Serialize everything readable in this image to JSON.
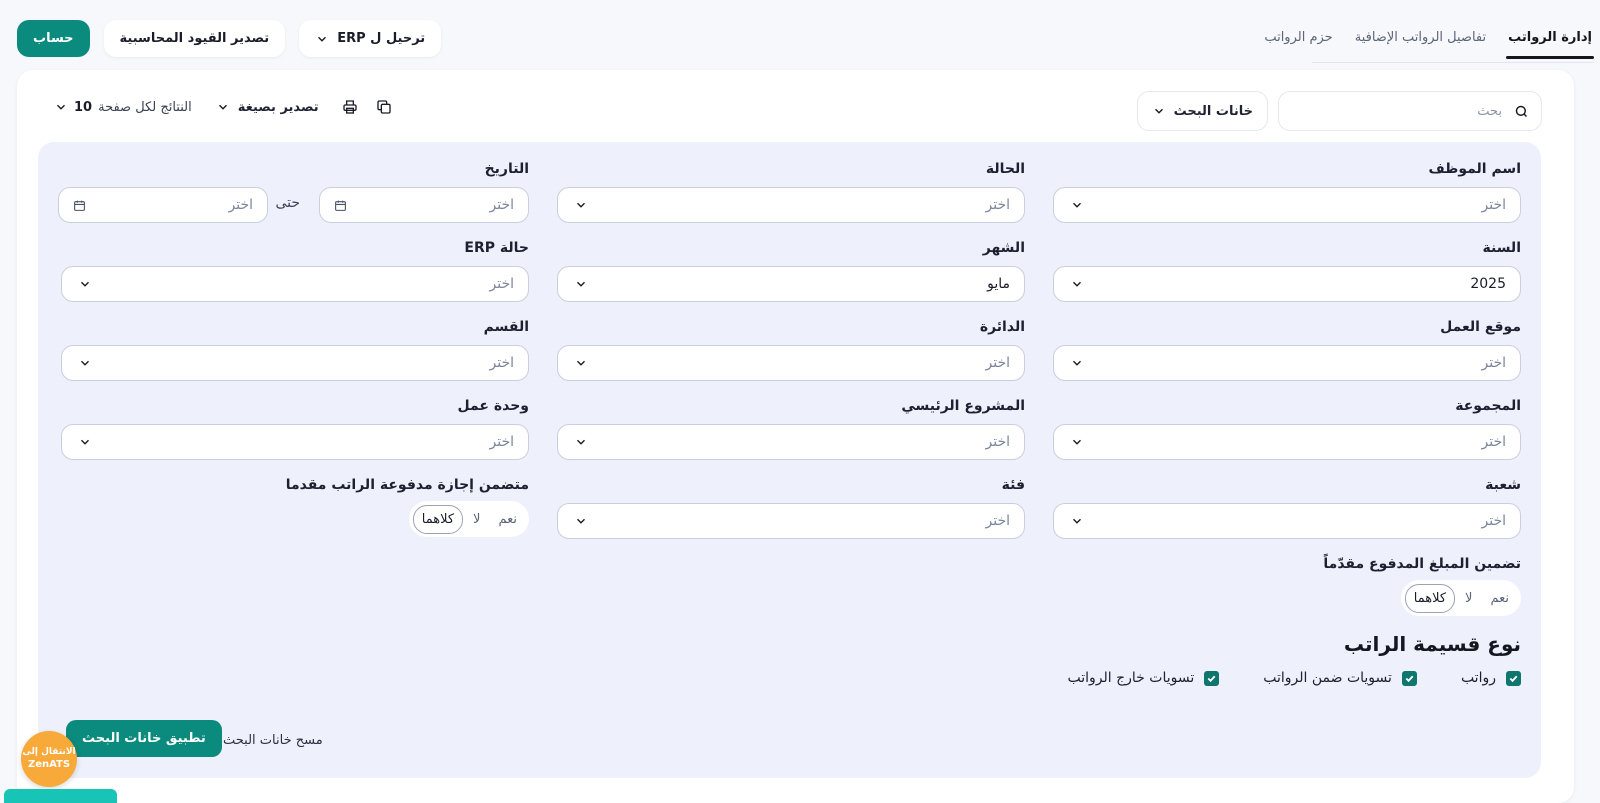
{
  "tabs": [
    {
      "label": "إدارة الرواتب",
      "active": true
    },
    {
      "label": "تفاصيل الرواتب الإضافية",
      "active": false
    },
    {
      "label": "حزم الرواتب",
      "active": false
    }
  ],
  "actions": {
    "account": "حساب",
    "export_entries": "تصدير القيود المحاسبية",
    "post_erp": "ترحيل ل ERP"
  },
  "search": {
    "placeholder": "بحث"
  },
  "search_fields_button": "خانات البحث",
  "toolbar": {
    "export_label": "تصدير بصيغة",
    "per_page_label": "النتائج لكل صفحة",
    "per_page_value": "10"
  },
  "filters": {
    "employee_name": {
      "label": "اسم الموظف",
      "value": "اختر"
    },
    "status": {
      "label": "الحالة",
      "value": "اختر"
    },
    "date": {
      "label": "التاريخ",
      "from": "اختر",
      "until": "حتى",
      "to": "اختر"
    },
    "year": {
      "label": "السنة",
      "value": "2025"
    },
    "month": {
      "label": "الشهر",
      "value": "مايو"
    },
    "erp_status": {
      "label": "حالة ERP",
      "value": "اختر"
    },
    "work_location": {
      "label": "موقع العمل",
      "value": "اختر"
    },
    "department": {
      "label": "الدائرة",
      "value": "اختر"
    },
    "section": {
      "label": "القسم",
      "value": "اختر"
    },
    "group": {
      "label": "المجموعة",
      "value": "اختر"
    },
    "main_project": {
      "label": "المشروع الرئيسي",
      "value": "اختر"
    },
    "work_unit": {
      "label": "وحدة عمل",
      "value": "اختر"
    },
    "branch": {
      "label": "شعبة",
      "value": "اختر"
    },
    "category": {
      "label": "فئة",
      "value": "اختر"
    },
    "includes_prepaid_leave": {
      "label": "متضمن إجازة مدفوعة الراتب مقدما",
      "options": [
        "نعم",
        "لا",
        "كلاهما"
      ],
      "selected": "كلاهما"
    },
    "include_prepaid_amount": {
      "label": "تضمين المبلغ المدفوع مقدّماً",
      "options": [
        "نعم",
        "لا",
        "كلاهما"
      ],
      "selected": "كلاهما"
    }
  },
  "slip_type": {
    "title": "نوع قسيمة الراتب",
    "options": [
      {
        "label": "رواتب",
        "checked": true
      },
      {
        "label": "تسويات ضمن الرواتب",
        "checked": true
      },
      {
        "label": "تسويات خارج الرواتب",
        "checked": true
      }
    ]
  },
  "buttons": {
    "apply": "تطبيق خانات البحث",
    "clear": "مسح خانات البحث"
  },
  "zen_badge": {
    "line1": "الانتقال إلى",
    "line2": "ZenATS"
  },
  "colors": {
    "primary": "#0b8a7e",
    "panel": "#eef1fb",
    "badge": "#f7a93a"
  }
}
